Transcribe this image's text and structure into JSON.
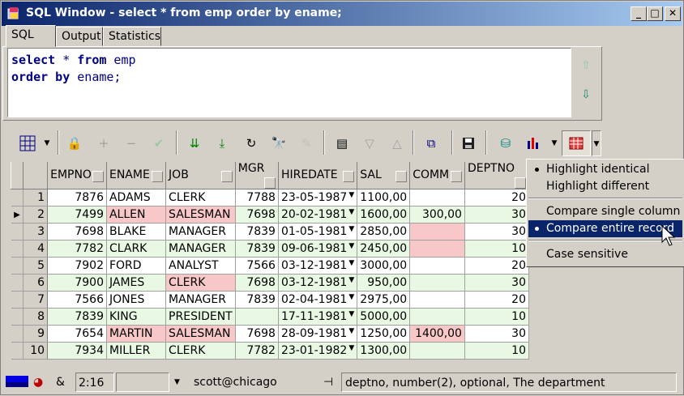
{
  "window": {
    "title": "SQL Window - select * from emp order by ename;",
    "min_label": "_",
    "max_label": "□",
    "close_label": "✕"
  },
  "tabs": [
    {
      "label": "SQL"
    },
    {
      "label": "Output"
    },
    {
      "label": "Statistics"
    }
  ],
  "editor": {
    "line1_kw1": "select",
    "line1_rest1": " * ",
    "line1_kw2": "from",
    "line1_rest2": " emp",
    "line2_kw": "order by",
    "line2_rest": " ename;"
  },
  "grid": {
    "columns": [
      "EMPNO",
      "ENAME",
      "JOB",
      "MGR",
      "HIREDATE",
      "SAL",
      "COMM",
      "DEPTNO"
    ],
    "rows": [
      [
        "1",
        "7876",
        "ADAMS",
        "CLERK",
        "7788",
        "23-05-1987",
        "1100,00",
        "",
        "20"
      ],
      [
        "2",
        "7499",
        "ALLEN",
        "SALESMAN",
        "7698",
        "20-02-1981",
        "1600,00",
        "300,00",
        "30"
      ],
      [
        "3",
        "7698",
        "BLAKE",
        "MANAGER",
        "7839",
        "01-05-1981",
        "2850,00",
        "",
        "30"
      ],
      [
        "4",
        "7782",
        "CLARK",
        "MANAGER",
        "7839",
        "09-06-1981",
        "2450,00",
        "",
        "10"
      ],
      [
        "5",
        "7902",
        "FORD",
        "ANALYST",
        "7566",
        "03-12-1981",
        "3000,00",
        "",
        "20"
      ],
      [
        "6",
        "7900",
        "JAMES",
        "CLERK",
        "7698",
        "03-12-1981",
        "950,00",
        "",
        "30"
      ],
      [
        "7",
        "7566",
        "JONES",
        "MANAGER",
        "7839",
        "02-04-1981",
        "2975,00",
        "",
        "20"
      ],
      [
        "8",
        "7839",
        "KING",
        "PRESIDENT",
        "",
        "17-11-1981",
        "5000,00",
        "",
        "10"
      ],
      [
        "9",
        "7654",
        "MARTIN",
        "SALESMAN",
        "7698",
        "28-09-1981",
        "1250,00",
        "1400,00",
        "30"
      ],
      [
        "10",
        "7934",
        "MILLER",
        "CLERK",
        "7782",
        "23-01-1982",
        "1300,00",
        "",
        "10"
      ]
    ]
  },
  "menu": {
    "items": [
      {
        "label": "Highlight identical",
        "checked": true
      },
      {
        "label": "Highlight different",
        "checked": false
      },
      {
        "label": "Compare single column",
        "checked": false
      },
      {
        "label": "Compare entire record",
        "checked": true,
        "selected": true
      },
      {
        "label": "Case sensitive",
        "checked": false
      }
    ]
  },
  "statusbar": {
    "position": "2:16",
    "connection": "scott@chicago",
    "column_info": "deptno, number(2), optional, The department",
    "amp": "&"
  },
  "colors": {
    "titlebar": "#0a246a",
    "diff_highlight": "#f8c8c8",
    "green_row": "#e8f8e2",
    "keyword": "#000080",
    "menu_selected": "#0a246a"
  }
}
